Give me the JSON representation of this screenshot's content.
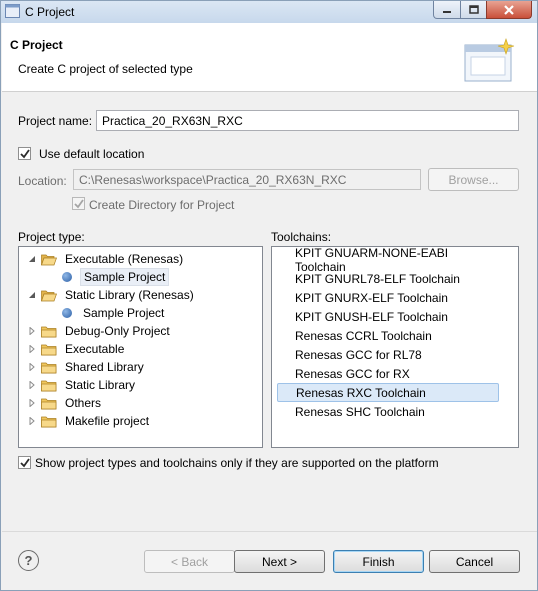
{
  "window": {
    "title": "C Project"
  },
  "header": {
    "title": "C Project",
    "description": "Create C project of selected type"
  },
  "project_name": {
    "label": "Project name:",
    "value": "Practica_20_RX63N_RXC"
  },
  "use_default_location": {
    "label": "Use default location",
    "checked": true
  },
  "location": {
    "label": "Location:",
    "value": "C:\\Renesas\\workspace\\Practica_20_RX63N_RXC",
    "browse_label": "Browse..."
  },
  "create_directory": {
    "label": "Create Directory for Project",
    "checked": true
  },
  "project_type": {
    "label": "Project type:",
    "items": [
      {
        "label": "Executable (Renesas)",
        "kind": "folder",
        "expanded": true,
        "level": 0
      },
      {
        "label": "Sample Project",
        "kind": "leaf",
        "level": 1,
        "selected": true
      },
      {
        "label": "Static Library (Renesas)",
        "kind": "folder",
        "expanded": true,
        "level": 0
      },
      {
        "label": "Sample Project",
        "kind": "leaf",
        "level": 1
      },
      {
        "label": "Debug-Only Project",
        "kind": "folder",
        "expanded": false,
        "level": 0
      },
      {
        "label": "Executable",
        "kind": "folder",
        "expanded": false,
        "level": 0
      },
      {
        "label": "Shared Library",
        "kind": "folder",
        "expanded": false,
        "level": 0
      },
      {
        "label": "Static Library",
        "kind": "folder",
        "expanded": false,
        "level": 0
      },
      {
        "label": "Others",
        "kind": "folder",
        "expanded": false,
        "level": 0
      },
      {
        "label": "Makefile project",
        "kind": "folder",
        "expanded": false,
        "level": 0
      }
    ]
  },
  "toolchains": {
    "label": "Toolchains:",
    "items": [
      "KPIT GNUARM-NONE-EABI Toolchain",
      "KPIT GNURL78-ELF Toolchain",
      "KPIT GNURX-ELF Toolchain",
      "KPIT GNUSH-ELF Toolchain",
      "Renesas CCRL Toolchain",
      "Renesas GCC for RL78",
      "Renesas GCC for RX",
      "Renesas RXC Toolchain",
      "Renesas SHC Toolchain"
    ],
    "selected": "Renesas RXC Toolchain"
  },
  "show_supported": {
    "label": "Show project types and toolchains only if they are supported on the platform",
    "checked": true
  },
  "buttons": {
    "help": "?",
    "back": "< Back",
    "next": "Next >",
    "finish": "Finish",
    "cancel": "Cancel"
  },
  "icons": {
    "app": "c-project-icon",
    "minimize": "minimize-icon",
    "maximize": "maximize-icon",
    "close": "close-icon",
    "wizard_banner": "new-project-wizard-icon",
    "folder": "folder-icon",
    "leaf": "sample-project-icon",
    "expanded": "expanded-triangle-icon",
    "collapsed": "collapsed-triangle-icon"
  },
  "colors": {
    "selection": "#dbe9f8",
    "selection_border": "#9ec2e8",
    "close_button": "#c9503a"
  }
}
